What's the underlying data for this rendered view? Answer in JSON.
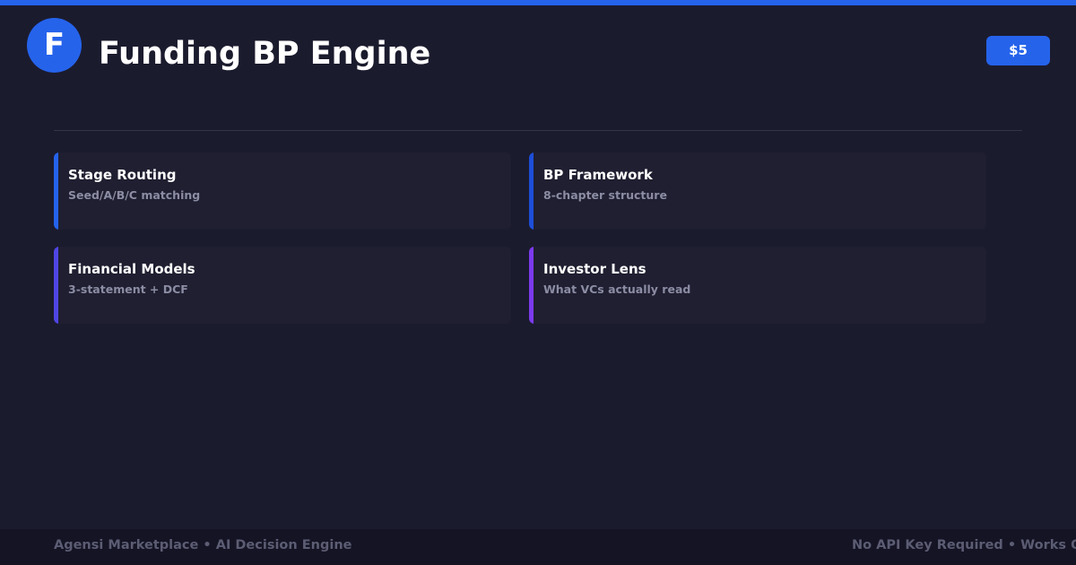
{
  "colors": {
    "background": "#1b1b2e",
    "accent": "#2563eb",
    "card_background": "#1f1f31",
    "footer_background": "#141424"
  },
  "header": {
    "logo_letter": "F",
    "title": "Funding BP Engine",
    "price": "$5"
  },
  "cards": [
    {
      "title": "Stage Routing",
      "subtitle": "Seed/A/B/C matching",
      "accent_color": "#2563eb"
    },
    {
      "title": "BP Framework",
      "subtitle": "8-chapter structure",
      "accent_color": "#1d4ed8"
    },
    {
      "title": "Financial Models",
      "subtitle": "3-statement + DCF",
      "accent_color": "#4f46e5"
    },
    {
      "title": "Investor Lens",
      "subtitle": "What VCs actually read",
      "accent_color": "#7c3aed"
    }
  ],
  "footer": {
    "left_text": "Agensi Marketplace • AI Decision Engine",
    "right_text": "No API Key Required • Works Offline"
  }
}
